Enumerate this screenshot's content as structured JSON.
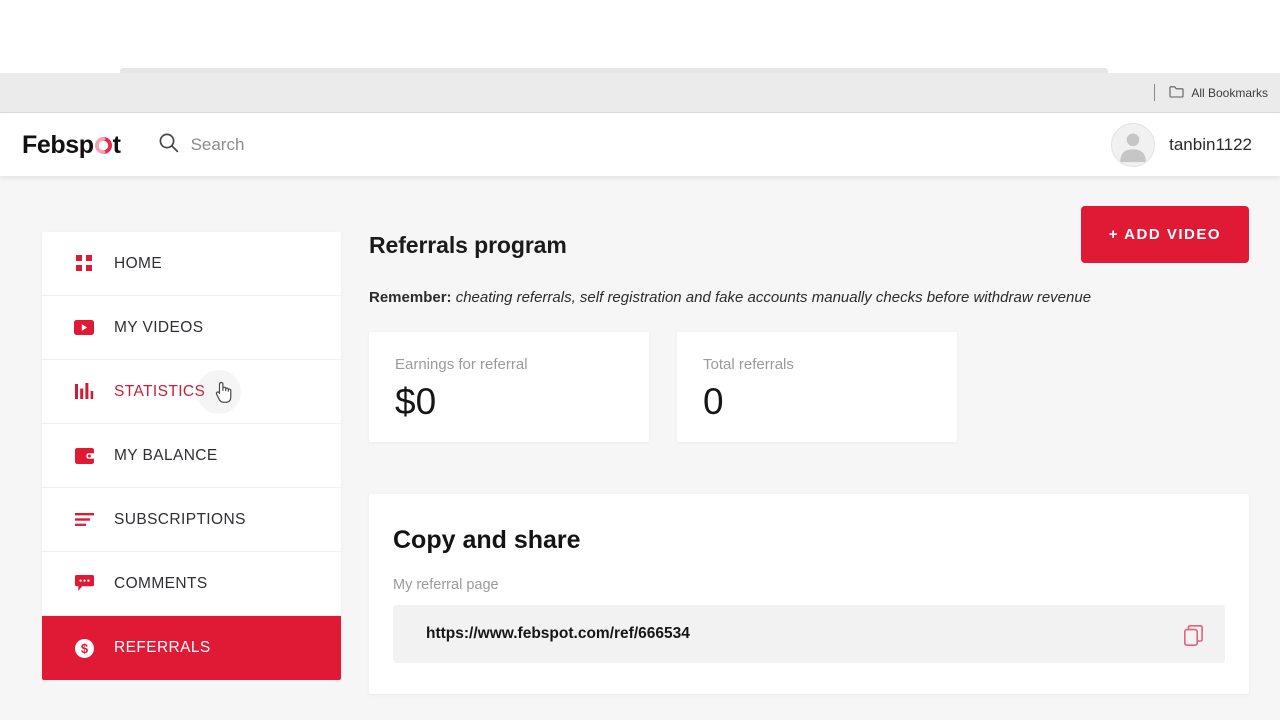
{
  "browser": {
    "bookmarks_label": "All Bookmarks",
    "folder_icon": "folder-icon"
  },
  "header": {
    "logo_before": "Febsp",
    "logo_after": "t",
    "logo_icon": "febspot-swirl-o",
    "search": {
      "icon": "search-icon",
      "placeholder": "Search",
      "value": ""
    },
    "user": {
      "avatar_icon": "user-avatar-placeholder",
      "username": "tanbin1122"
    }
  },
  "sidebar": {
    "items": [
      {
        "label": "HOME",
        "icon": "grid-dots-icon",
        "state": "default"
      },
      {
        "label": "MY VIDEOS",
        "icon": "video-play-icon",
        "state": "default"
      },
      {
        "label": "STATISTICS",
        "icon": "bar-chart-icon",
        "state": "hovered"
      },
      {
        "label": "MY BALANCE",
        "icon": "wallet-icon",
        "state": "default"
      },
      {
        "label": "SUBSCRIPTIONS",
        "icon": "list-lines-icon",
        "state": "default"
      },
      {
        "label": "COMMENTS",
        "icon": "comment-bubble-icon",
        "state": "default"
      },
      {
        "label": "REFERRALS",
        "icon": "dollar-circle-icon",
        "state": "active"
      }
    ]
  },
  "main": {
    "page_title": "Referrals program",
    "add_video_button": "+ ADD VIDEO",
    "remember": {
      "prefix": "Remember:",
      "text": "cheating referrals, self registration and fake accounts manually checks before withdraw revenue"
    },
    "stats": [
      {
        "label": "Earnings for referral",
        "value": "$0"
      },
      {
        "label": "Total referrals",
        "value": "0"
      }
    ],
    "share": {
      "title": "Copy and share",
      "field_label": "My referral page",
      "url": "https://www.febspot.com/ref/666534",
      "copy_icon": "copy-icon"
    }
  },
  "colors": {
    "accent_red": "#e01935",
    "hover_red": "#cf1b36",
    "page_bg": "#f6f6f6",
    "card_bg": "#ffffff"
  }
}
